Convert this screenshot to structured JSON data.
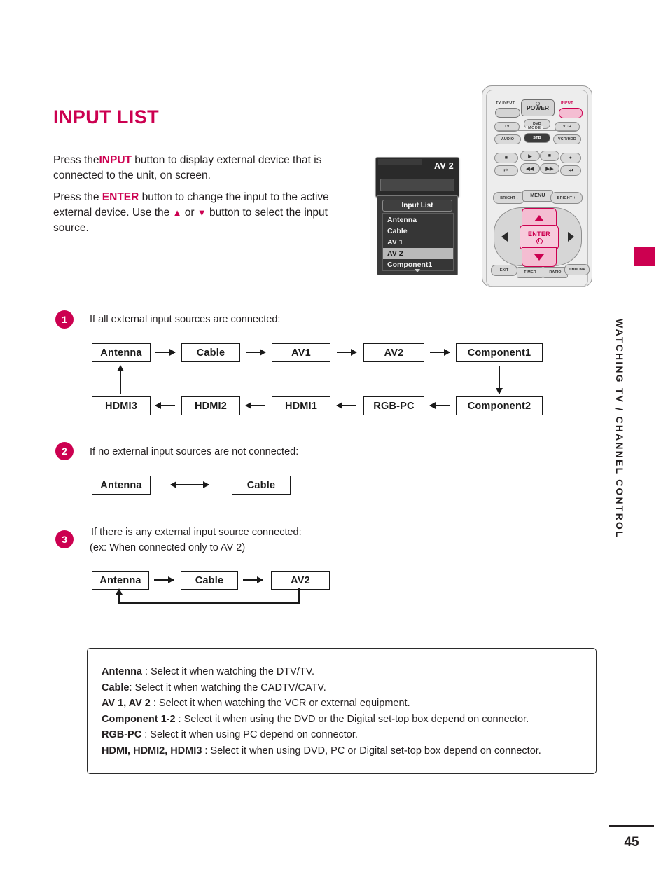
{
  "page": {
    "title": "INPUT LIST",
    "number": "45",
    "side_tab_label": "WATCHING TV / CHANNEL CONTROL",
    "accent_color": "#CC0050"
  },
  "intro": {
    "line1_a": "Press the",
    "line1_kw": "INPUT",
    "line1_b": " button to display external device that is connected to the unit, on screen.",
    "line2_a": "Press the ",
    "line2_kw": "ENTER",
    "line2_b": " button to change the input to the active external device. Use the ",
    "up_glyph": "▲",
    "line2_c": " or ",
    "down_glyph": "▼",
    "line2_d": " button to select the input source."
  },
  "tv_osd": {
    "current_input": "AV 2",
    "list_title": "Input List",
    "items": [
      "Antenna",
      "Cable",
      "AV 1",
      "AV 2",
      "Component1"
    ],
    "selected": "AV 2",
    "more_glyph": "▼"
  },
  "remote": {
    "tv_input_label": "TV INPUT",
    "power_label": "POWER",
    "input_label": "INPUT",
    "mode_label": "MODE",
    "mode_row1": [
      "TV",
      "DVD",
      "VCR"
    ],
    "mode_row2": [
      "AUDIO",
      "STB",
      "VCR/HDD"
    ],
    "transport_row1": [
      "■",
      "▶",
      "■",
      "●"
    ],
    "transport_row2": [
      "⏮",
      "◀◀",
      "▶▶",
      "⏭"
    ],
    "bright_minus": "BRIGHT -",
    "menu_label": "MENU",
    "bright_plus": "BRIGHT +",
    "enter_label": "ENTER",
    "bottom_row": [
      "EXIT",
      "TIMER",
      "RATIO",
      "SIMPLINK"
    ]
  },
  "steps": [
    {
      "number": "1",
      "text": "If all external input sources are connected:",
      "row_top": [
        "Antenna",
        "Cable",
        "AV1",
        "AV2",
        "Component1"
      ],
      "row_bottom": [
        "HDMI3",
        "HDMI2",
        "HDMI1",
        "RGB-PC",
        "Component2"
      ]
    },
    {
      "number": "2",
      "text": "If no external input sources are not connected:",
      "boxes": [
        "Antenna",
        "Cable"
      ]
    },
    {
      "number": "3",
      "text_line1": "If there is any external input source connected:",
      "text_line2": "(ex: When connected only to AV 2)",
      "boxes": [
        "Antenna",
        "Cable",
        "AV2"
      ]
    }
  ],
  "legend": {
    "rows": [
      {
        "term": "Antenna",
        "desc": " : Select it when watching the DTV/TV."
      },
      {
        "term": "Cable",
        "desc": ": Select it when watching the CADTV/CATV."
      },
      {
        "term": "AV 1, AV 2",
        "desc": " : Select it when watching the VCR or external equipment."
      },
      {
        "term": "Component 1-2",
        "desc": " : Select it when using the DVD or the Digital set-top box depend on connector."
      },
      {
        "term": "RGB-PC",
        "desc": " : Select it when using PC depend on connector."
      },
      {
        "term": "HDMI, HDMI2, HDMI3",
        "desc": " : Select it when using DVD, PC or Digital set-top box depend on connector."
      }
    ]
  }
}
